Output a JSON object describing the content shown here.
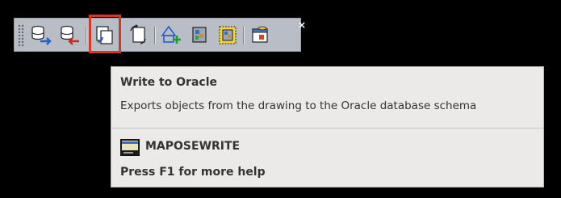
{
  "toolbar": {
    "buttons": [
      {
        "icon": "import-from-oracle-icon"
      },
      {
        "icon": "export-to-oracle-icon"
      },
      {
        "icon": "write-to-oracle-icon",
        "highlighted": true
      },
      {
        "icon": "copy-objects-icon"
      },
      {
        "icon": "add-shape-icon"
      },
      {
        "icon": "map-tile-icon"
      },
      {
        "icon": "map-tile-selected-icon"
      },
      {
        "icon": "properties-icon"
      }
    ],
    "close_icon": "×",
    "highlight_color": "#d23a27"
  },
  "tooltip": {
    "title": "Write to Oracle",
    "description": "Exports objects from the drawing to the Oracle database schema",
    "command_icon": "command-window-icon",
    "command": "MAPOSEWRITE",
    "help": "Press F1 for more help"
  }
}
